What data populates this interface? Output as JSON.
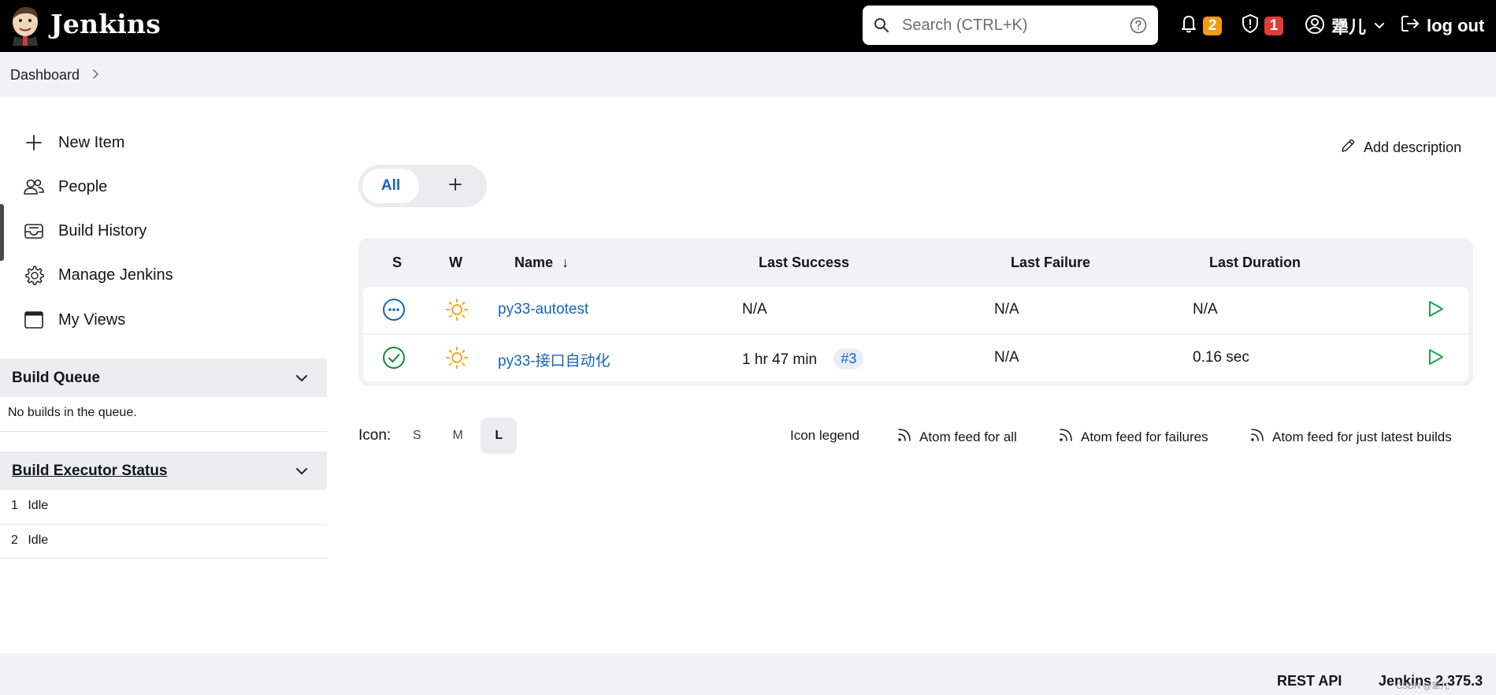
{
  "header": {
    "brand": "Jenkins",
    "search_placeholder": "Search (CTRL+K)",
    "notifications_count": "2",
    "security_count": "1",
    "user_name": "犟儿",
    "logout_label": "log out"
  },
  "breadcrumb": {
    "item": "Dashboard"
  },
  "sidebar": {
    "tasks": [
      {
        "label": "New Item",
        "icon": "plus-icon"
      },
      {
        "label": "People",
        "icon": "people-icon"
      },
      {
        "label": "Build History",
        "icon": "inbox-icon"
      },
      {
        "label": "Manage Jenkins",
        "icon": "gear-icon"
      },
      {
        "label": "My Views",
        "icon": "window-icon"
      }
    ],
    "build_queue": {
      "title": "Build Queue",
      "empty_text": "No builds in the queue."
    },
    "executors": {
      "title": "Build Executor Status",
      "rows": [
        {
          "num": "1",
          "status": "Idle"
        },
        {
          "num": "2",
          "status": "Idle"
        }
      ]
    }
  },
  "main": {
    "add_description": "Add description",
    "tabs": {
      "all": "All"
    },
    "table": {
      "headers": {
        "s": "S",
        "w": "W",
        "name": "Name",
        "sort_arrow": "↓",
        "last_success": "Last Success",
        "last_failure": "Last Failure",
        "last_duration": "Last Duration"
      },
      "rows": [
        {
          "status_icon": "not-built-icon",
          "weather_icon": "sunny-icon",
          "name": "py33-autotest",
          "last_success": "N/A",
          "build_number": "",
          "last_failure": "N/A",
          "last_duration": "N/A"
        },
        {
          "status_icon": "success-icon",
          "weather_icon": "sunny-icon",
          "name": "py33-接口自动化",
          "last_success": "1 hr 47 min",
          "build_number": "#3",
          "last_failure": "N/A",
          "last_duration": "0.16 sec"
        }
      ]
    },
    "icon_size": {
      "label": "Icon:",
      "options": [
        "S",
        "M",
        "L"
      ],
      "selected": "L"
    },
    "links": {
      "icon_legend": "Icon legend",
      "feed_all": "Atom feed for all",
      "feed_failures": "Atom feed for failures",
      "feed_latest": "Atom feed for just latest builds"
    }
  },
  "footer": {
    "rest_api": "REST API",
    "version": "Jenkins 2.375.3",
    "watermark": "CSDN @犟儿"
  },
  "colors": {
    "accent": "#1565c0",
    "success": "#138a36",
    "play": "#1ea446",
    "weather": "#f5a623",
    "badge_orange": "#f39c12",
    "badge_red": "#e43b3b"
  }
}
